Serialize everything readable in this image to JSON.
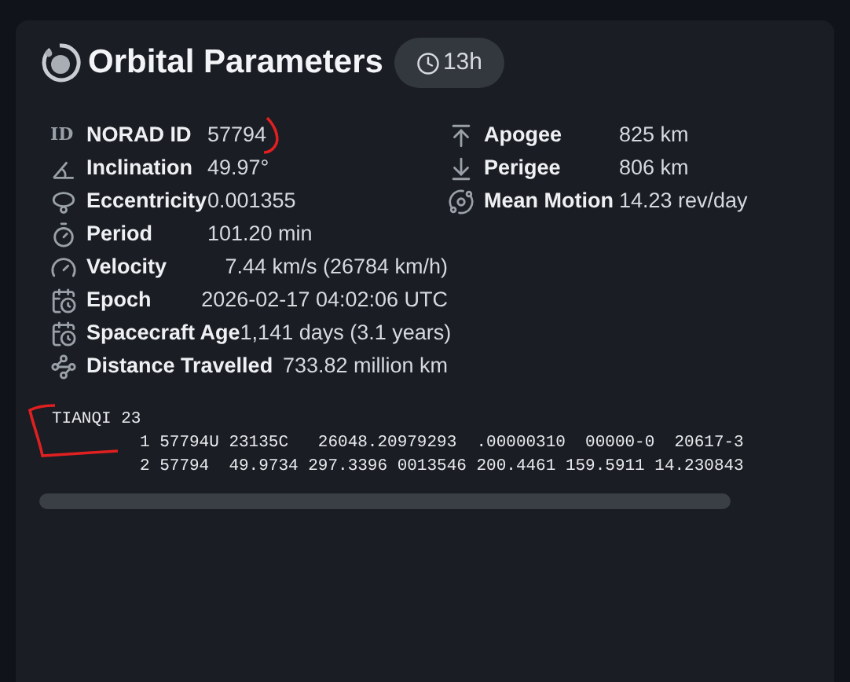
{
  "card": {
    "title": "Orbital Parameters",
    "age_badge": "13h"
  },
  "left_primary": [
    {
      "kind": "id",
      "icon_text": "ID",
      "label": "NORAD ID",
      "value": "57794"
    },
    {
      "kind": "inclination",
      "label": "Inclination",
      "value": "49.97°"
    },
    {
      "kind": "eccentricity",
      "label": "Eccentricity",
      "value": "0.001355"
    },
    {
      "kind": "period",
      "label": "Period",
      "value": "101.20 min"
    }
  ],
  "left_secondary": [
    {
      "kind": "velocity",
      "label": "Velocity",
      "value": "7.44 km/s (26784 km/h)"
    },
    {
      "kind": "epoch",
      "label": "Epoch",
      "value": "2026-02-17 04:02:06 UTC"
    },
    {
      "kind": "age",
      "label": "Spacecraft Age",
      "value": "1,141 days (3.1 years)"
    },
    {
      "kind": "distance",
      "label": "Distance Travelled",
      "value": "733.82 million km"
    }
  ],
  "right": [
    {
      "kind": "apogee",
      "label": "Apogee",
      "value": "825 km"
    },
    {
      "kind": "perigee",
      "label": "Perigee",
      "value": "806 km"
    },
    {
      "kind": "mean_motion",
      "label": "Mean Motion",
      "value": "14.23 rev/day"
    }
  ],
  "tle": {
    "name": "TIANQI 23",
    "lines": [
      "1 57794U 23135C   26048.20979293  .00000310  00000-0  20617-3",
      "2 57794  49.9734 297.3396 0013546 200.4461 159.5911 14.230843"
    ]
  }
}
